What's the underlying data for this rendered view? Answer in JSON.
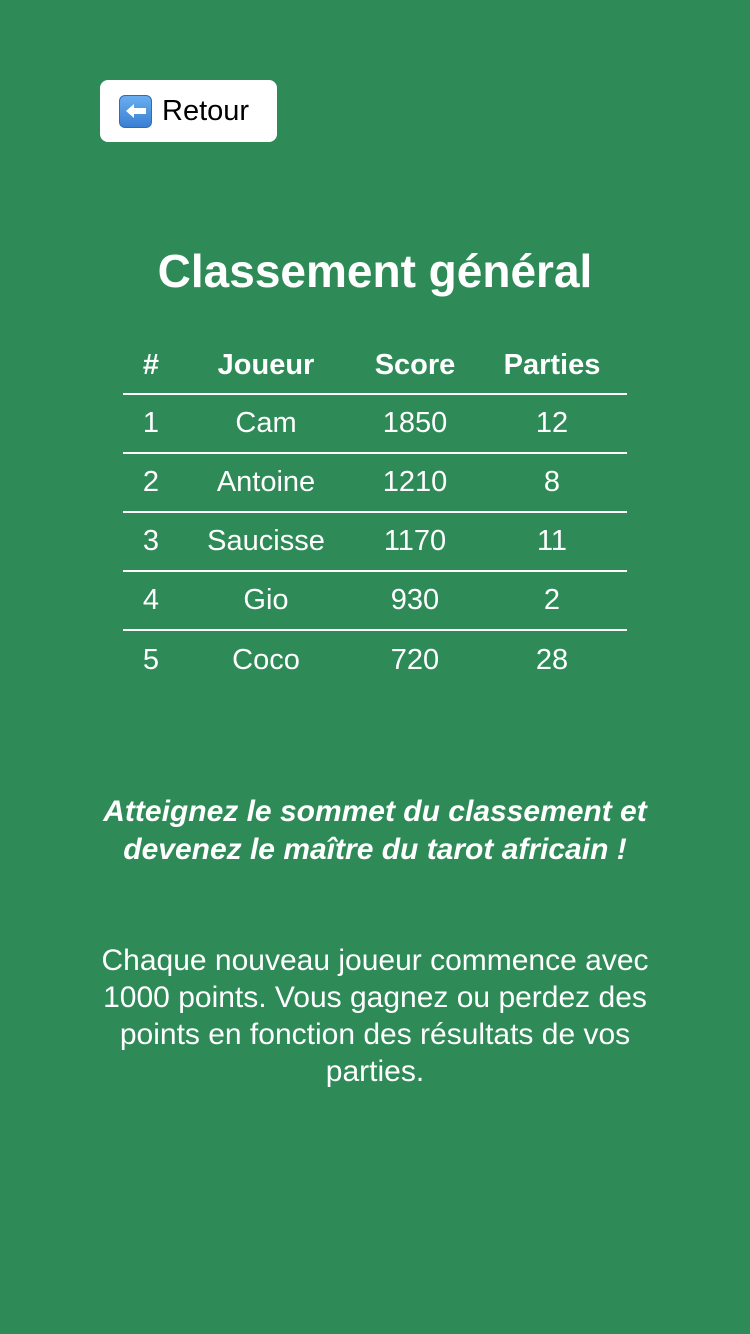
{
  "back_button": {
    "label": "Retour",
    "icon": "left-arrow-icon"
  },
  "page_title": "Classement général",
  "leaderboard": {
    "columns": [
      "#",
      "Joueur",
      "Score",
      "Parties"
    ],
    "rows": [
      {
        "rank": "1",
        "player": "Cam",
        "score": "1850",
        "games": "12"
      },
      {
        "rank": "2",
        "player": "Antoine",
        "score": "1210",
        "games": "8"
      },
      {
        "rank": "3",
        "player": "Saucisse",
        "score": "1170",
        "games": "11"
      },
      {
        "rank": "4",
        "player": "Gio",
        "score": "930",
        "games": "2"
      },
      {
        "rank": "5",
        "player": "Coco",
        "score": "720",
        "games": "28"
      }
    ]
  },
  "tagline": "Atteignez le sommet du classement et devenez le maître du tarot africain !",
  "description": "Chaque nouveau joueur commence avec 1000 points. Vous gagnez ou perdez des points en fonction des résultats de vos parties.",
  "colors": {
    "background": "#2e8b57",
    "text": "#ffffff",
    "button_background": "#ffffff"
  }
}
